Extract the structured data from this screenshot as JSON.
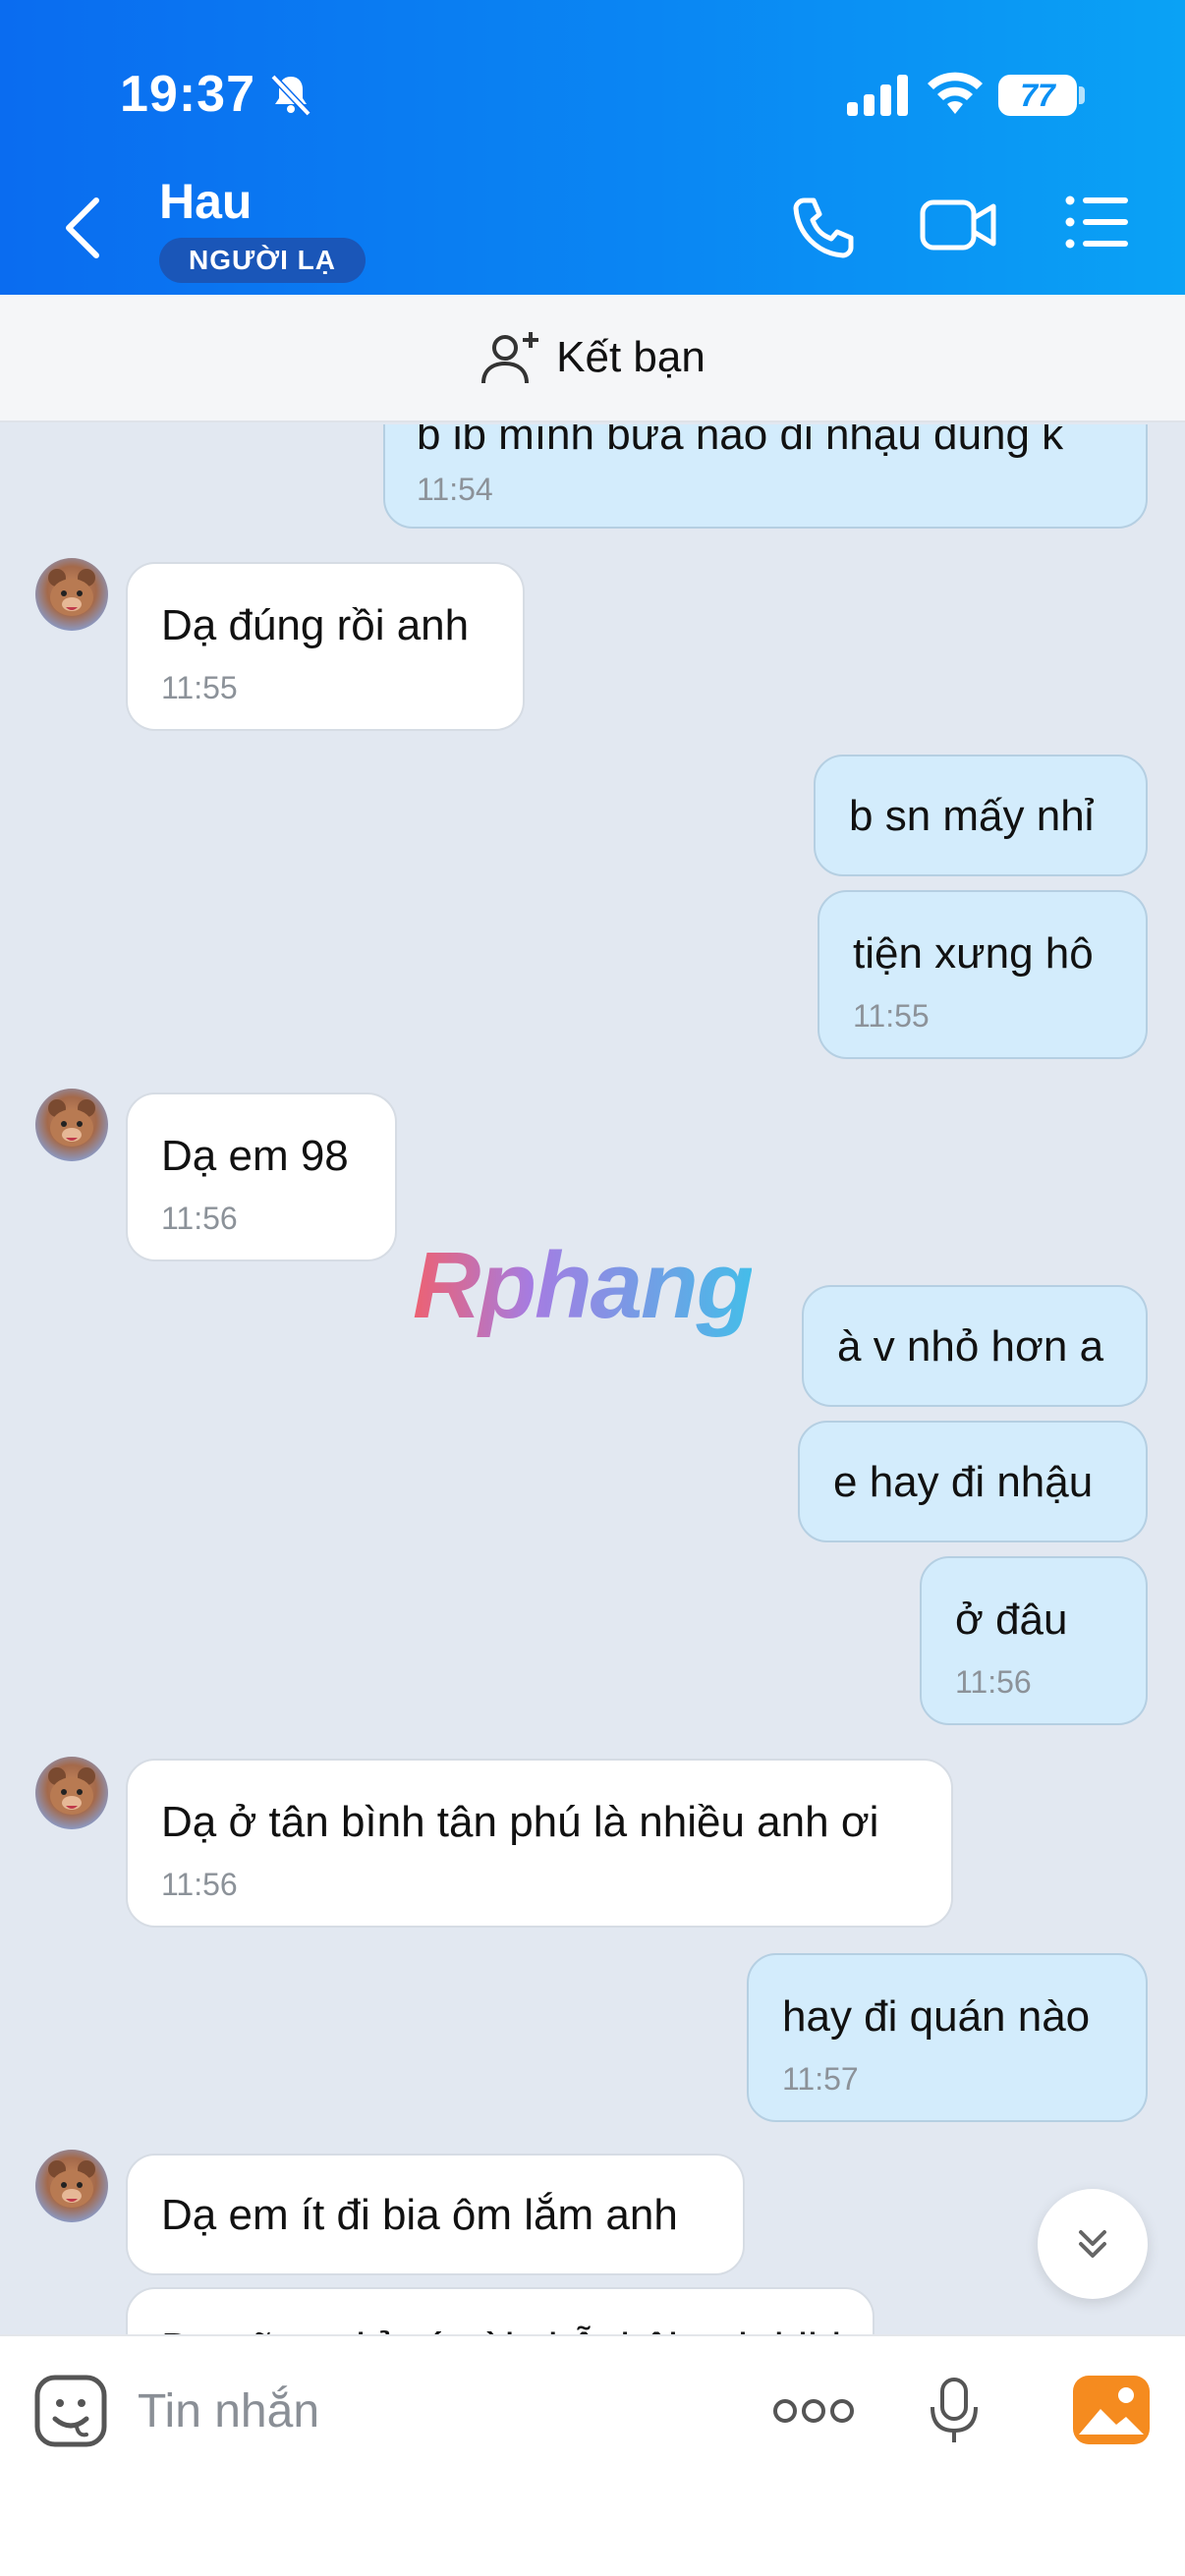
{
  "status_bar": {
    "time": "19:37",
    "battery": "77"
  },
  "header": {
    "name": "Hau",
    "badge": "NGƯỜI LẠ"
  },
  "add_friend": {
    "label": "Kết bạn"
  },
  "watermark": "Rphang",
  "messages": [
    {
      "dir": "out",
      "text": "b ib mình bữa nào đi nhậu đúng k",
      "time": "11:54"
    },
    {
      "dir": "in",
      "text": "Dạ đúng rồi anh",
      "time": "11:55"
    },
    {
      "dir": "out",
      "text": "b sn mấy nhỉ",
      "time": ""
    },
    {
      "dir": "out",
      "text": "tiện xưng hô",
      "time": "11:55"
    },
    {
      "dir": "in",
      "text": "Dạ em 98",
      "time": "11:56"
    },
    {
      "dir": "out",
      "text": "à v nhỏ hơn a",
      "time": ""
    },
    {
      "dir": "out",
      "text": "e hay đi nhậu",
      "time": ""
    },
    {
      "dir": "out",
      "text": "ở đâu",
      "time": "11:56"
    },
    {
      "dir": "in",
      "text": "Dạ ở tân bình tân phú là nhiều anh ơi",
      "time": "11:56"
    },
    {
      "dir": "out",
      "text": "hay đi quán nào",
      "time": "11:57"
    },
    {
      "dir": "in",
      "text": "Dạ em ít đi bia ôm lắm anh",
      "time": ""
    },
    {
      "dir": "in",
      "text": "Dạ cũng chỉ có vài chỗ thôi anh hihi",
      "time": ""
    }
  ],
  "composer": {
    "placeholder": "Tin nhắn"
  },
  "colors": {
    "header_start": "#0a6cf0",
    "header_end": "#0aa2f5",
    "outgoing": "#d3ecfc",
    "incoming": "#ffffff",
    "chat_bg": "#e2e8f1"
  }
}
